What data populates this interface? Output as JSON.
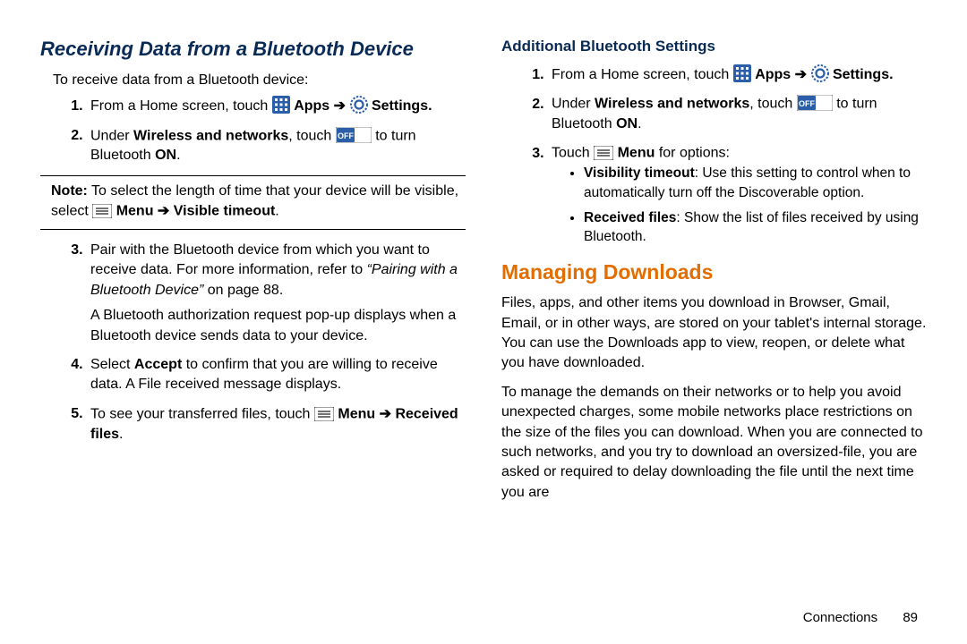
{
  "left": {
    "heading": "Receiving Data from a Bluetooth Device",
    "intro": "To receive data from a Bluetooth device:",
    "step1_a": "From a Home screen, touch ",
    "step1_apps": " Apps ",
    "step1_settings": " Settings.",
    "step2_a": "Under ",
    "step2_b": "Wireless and networks",
    "step2_c": ", touch ",
    "step2_d": " to turn Bluetooth ",
    "step2_on": "ON",
    "note_label": "Note:",
    "note_a": " To select the length of time that your device will be visible, select ",
    "note_menu": " Menu ",
    "note_vt": " Visible timeout",
    "step3_a": "Pair with the Bluetooth device from which you want to receive data. For more information, refer to ",
    "step3_ref": "“Pairing with a Bluetooth Device”",
    "step3_b": " on page 88.",
    "step3_sub": "A Bluetooth authorization request pop-up displays when a Bluetooth device sends data to your device.",
    "step4_a": "Select ",
    "step4_accept": "Accept",
    "step4_b": " to confirm that you are willing to receive data. A File received message displays.",
    "step5_a": "To see your transferred files, touch ",
    "step5_menu": " Menu ",
    "step5_rf": "Received files"
  },
  "right": {
    "subhead": "Additional Bluetooth Settings",
    "s1_a": "From a Home screen, touch ",
    "s1_apps": " Apps ",
    "s1_settings": " Settings.",
    "s2_a": "Under ",
    "s2_b": "Wireless and networks",
    "s2_c": ", touch ",
    "s2_d": " to turn Bluetooth ",
    "s2_on": "ON",
    "s3_a": "Touch ",
    "s3_menu": " Menu",
    "s3_b": " for options:",
    "b1_label": "Visibility timeout",
    "b1_text": ": Use this setting to control when to automatically turn off the Discoverable option.",
    "b2_label": "Received files",
    "b2_text": ": Show the list of files received by using Bluetooth.",
    "orange_heading": "Managing Downloads",
    "para1": "Files, apps, and other items you download in Browser, Gmail, Email, or in other ways, are stored on your tablet's internal storage. You can use the Downloads app to view, reopen, or delete what you have downloaded.",
    "para2": "To manage the demands on their networks or to help you avoid unexpected charges, some mobile networks place restrictions on the size of the files you can download. When you are connected to such networks, and you try to download an oversized-file, you are asked or required to delay downloading the file until the next time you are"
  },
  "footer": {
    "section": "Connections",
    "page": "89"
  },
  "icons": {
    "arrow": "➔"
  }
}
